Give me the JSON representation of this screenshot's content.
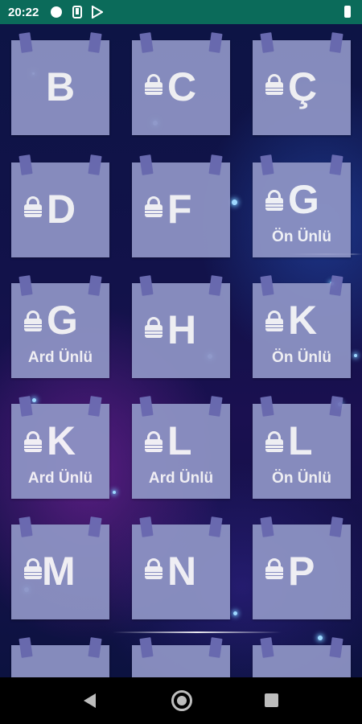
{
  "status_bar": {
    "time": "20:22",
    "icons": [
      "circle-notification-icon",
      "phone-icon",
      "play-store-icon",
      "battery-icon"
    ]
  },
  "cards": [
    {
      "letter": "B",
      "locked": false,
      "sub": ""
    },
    {
      "letter": "C",
      "locked": true,
      "sub": ""
    },
    {
      "letter": "Ç",
      "locked": true,
      "sub": ""
    },
    {
      "letter": "D",
      "locked": true,
      "sub": ""
    },
    {
      "letter": "F",
      "locked": true,
      "sub": ""
    },
    {
      "letter": "G",
      "locked": true,
      "sub": "Ön Ünlü"
    },
    {
      "letter": "G",
      "locked": true,
      "sub": "Ard Ünlü"
    },
    {
      "letter": "H",
      "locked": true,
      "sub": ""
    },
    {
      "letter": "K",
      "locked": true,
      "sub": "Ön Ünlü"
    },
    {
      "letter": "K",
      "locked": true,
      "sub": "Ard Ünlü"
    },
    {
      "letter": "L",
      "locked": true,
      "sub": "Ard Ünlü"
    },
    {
      "letter": "L",
      "locked": true,
      "sub": "Ön Ünlü"
    },
    {
      "letter": "M",
      "locked": true,
      "sub": ""
    },
    {
      "letter": "N",
      "locked": true,
      "sub": ""
    },
    {
      "letter": "P",
      "locked": true,
      "sub": ""
    },
    {
      "letter": "",
      "locked": false,
      "sub": ""
    },
    {
      "letter": "",
      "locked": false,
      "sub": ""
    },
    {
      "letter": "",
      "locked": false,
      "sub": ""
    }
  ],
  "nav_bar": {
    "buttons": [
      "back-icon",
      "home-icon",
      "recent-apps-icon"
    ]
  }
}
